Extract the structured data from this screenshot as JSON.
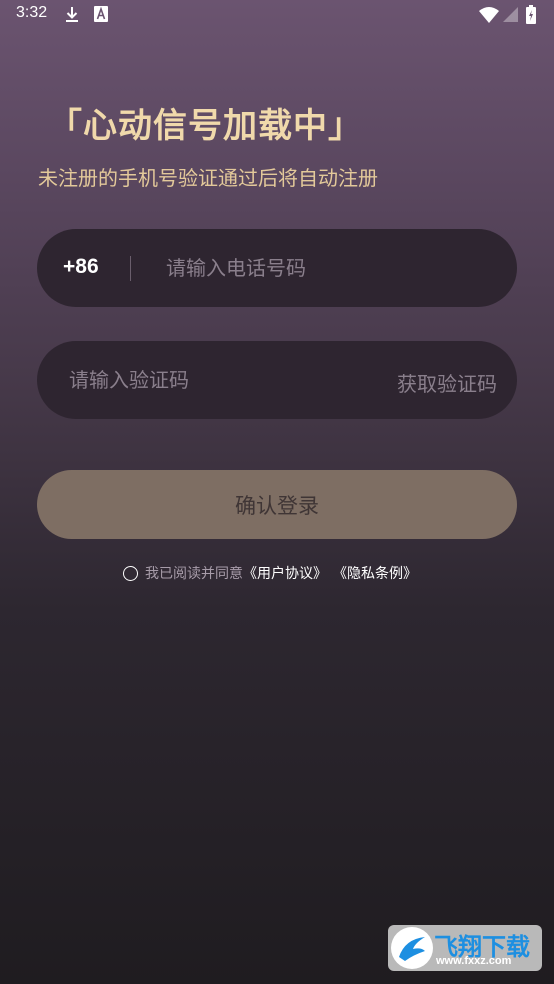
{
  "status_bar": {
    "time": "3:32",
    "icons": [
      "download-icon",
      "notification-a-icon",
      "wifi-icon",
      "signal-icon",
      "battery-icon"
    ]
  },
  "header": {
    "title": "「心动信号加载中」",
    "subtitle": "未注册的手机号验证通过后将自动注册"
  },
  "phone_field": {
    "country_code": "+86",
    "placeholder": "请输入电话号码",
    "value": ""
  },
  "code_field": {
    "placeholder": "请输入验证码",
    "value": "",
    "get_code_label": "获取验证码"
  },
  "login_button": {
    "label": "确认登录"
  },
  "agreement": {
    "checked": false,
    "prefix": "我已阅读并同意",
    "user_agreement": "《用户协议》",
    "privacy_policy": "《隐私条例》"
  },
  "watermark": {
    "title": "飞翔下载",
    "url": "www.fxxz.com"
  },
  "colors": {
    "title": "#f0d9ab",
    "subtitle": "#e3c99a",
    "field_background": "#2e2530",
    "button_background": "#7e6e63",
    "watermark_title": "#1d8fe1"
  }
}
